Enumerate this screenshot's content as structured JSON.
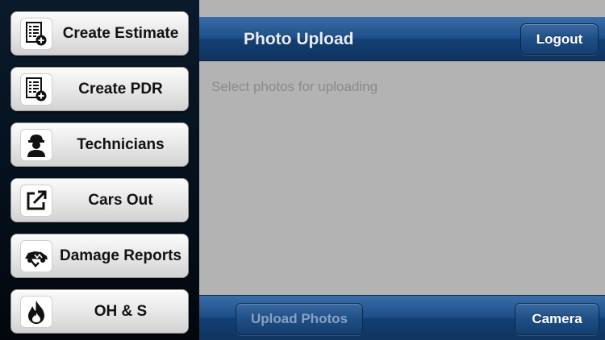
{
  "sidebar": {
    "items": [
      {
        "label": "Create Estimate",
        "icon": "document-add-icon"
      },
      {
        "label": "Create PDR",
        "icon": "document-add-icon"
      },
      {
        "label": "Technicians",
        "icon": "technician-icon"
      },
      {
        "label": "Cars Out",
        "icon": "external-link-icon"
      },
      {
        "label": "Damage Reports",
        "icon": "car-damage-icon"
      },
      {
        "label": "OH & S",
        "icon": "flame-icon"
      }
    ]
  },
  "header": {
    "title": "Photo Upload",
    "logout_label": "Logout"
  },
  "main": {
    "placeholder": "Select photos for uploading"
  },
  "toolbar": {
    "upload_label": "Upload Photos",
    "upload_enabled": false,
    "camera_label": "Camera"
  },
  "colors": {
    "navbar": "#1d4f8a",
    "content_bg": "#b3b3b3",
    "sidebar_bg": "#05101c"
  }
}
